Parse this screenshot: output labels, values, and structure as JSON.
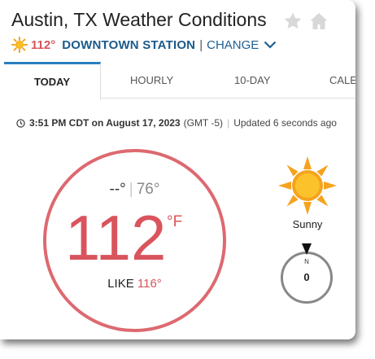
{
  "header": {
    "title": "Austin, TX Weather Conditions",
    "current_temp": "112°",
    "station": "DOWNTOWN STATION",
    "separator": "|",
    "change_label": "CHANGE"
  },
  "tabs": [
    {
      "label": "TODAY",
      "active": true
    },
    {
      "label": "HOURLY"
    },
    {
      "label": "10-DAY"
    },
    {
      "label": "CALE"
    }
  ],
  "observation": {
    "time": "3:51 PM CDT on August 17, 2023",
    "tz": "(GMT -5)",
    "separator": "|",
    "updated": "Updated 6 seconds ago"
  },
  "current": {
    "high": "--°",
    "separator": "|",
    "low": "76°",
    "temp": "112",
    "unit": "°F",
    "like_label": "LIKE",
    "like_value": "116°",
    "condition": "Sunny",
    "wind_dir": "N",
    "wind_speed": "0"
  },
  "icons": {
    "sun": "sun-icon",
    "star": "star-icon",
    "home": "home-icon",
    "clock": "clock-icon"
  },
  "colors": {
    "temp_red": "#d9545d",
    "link_blue": "#1f5f93",
    "tab_accent": "#2a7fc0",
    "sun_orange": "#f5a31e"
  }
}
